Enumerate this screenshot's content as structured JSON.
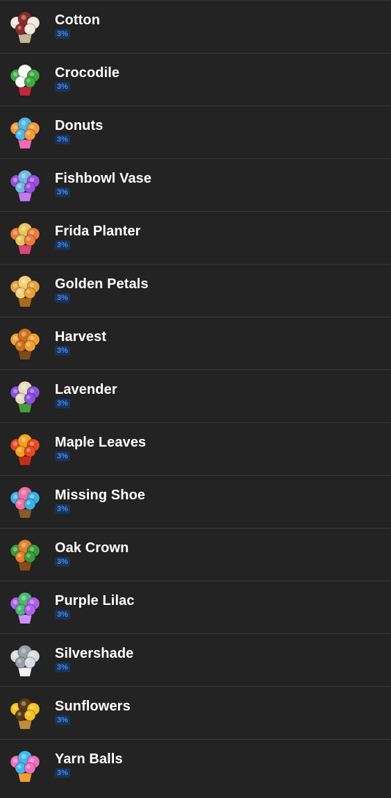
{
  "items": [
    {
      "name": "Cotton",
      "percent": "3%",
      "icon": "cotton-icon",
      "colors": [
        "#f3e8dc",
        "#8b2b2b",
        "#c9b49c"
      ]
    },
    {
      "name": "Crocodile",
      "percent": "3%",
      "icon": "crocodile-icon",
      "colors": [
        "#3fa844",
        "#ffffff",
        "#c0283a"
      ]
    },
    {
      "name": "Donuts",
      "percent": "3%",
      "icon": "donuts-icon",
      "colors": [
        "#f29a3d",
        "#4fb6e8",
        "#f06bb0"
      ]
    },
    {
      "name": "Fishbowl Vase",
      "percent": "3%",
      "icon": "fishbowl-vase-icon",
      "colors": [
        "#9b4fe0",
        "#6fb8e0",
        "#c37af0"
      ]
    },
    {
      "name": "Frida Planter",
      "percent": "3%",
      "icon": "frida-planter-icon",
      "colors": [
        "#f07a3a",
        "#e8c55a",
        "#d44a7a"
      ]
    },
    {
      "name": "Golden Petals",
      "percent": "3%",
      "icon": "golden-petals-icon",
      "colors": [
        "#e8a23a",
        "#f5cf7a",
        "#a86a1e"
      ]
    },
    {
      "name": "Harvest",
      "percent": "3%",
      "icon": "harvest-icon",
      "colors": [
        "#f0a030",
        "#d0701e",
        "#7a4a20"
      ]
    },
    {
      "name": "Lavender",
      "percent": "3%",
      "icon": "lavender-icon",
      "colors": [
        "#8a50e0",
        "#e8dcc0",
        "#4a9a3a"
      ]
    },
    {
      "name": "Maple Leaves",
      "percent": "3%",
      "icon": "maple-leaves-icon",
      "colors": [
        "#e84a1e",
        "#f5a020",
        "#c0301a"
      ]
    },
    {
      "name": "Missing Shoe",
      "percent": "3%",
      "icon": "missing-shoe-icon",
      "colors": [
        "#3ab0e8",
        "#f070a0",
        "#8a5a2a"
      ]
    },
    {
      "name": "Oak Crown",
      "percent": "3%",
      "icon": "oak-crown-icon",
      "colors": [
        "#3a9a3a",
        "#e0802a",
        "#8a4a20"
      ]
    },
    {
      "name": "Purple Lilac",
      "percent": "3%",
      "icon": "purple-lilac-icon",
      "colors": [
        "#b060f0",
        "#4ab870",
        "#d090ff"
      ]
    },
    {
      "name": "Silvershade",
      "percent": "3%",
      "icon": "silvershade-icon",
      "colors": [
        "#d8dce0",
        "#9aa0a8",
        "#f4f6f8"
      ]
    },
    {
      "name": "Sunflowers",
      "percent": "3%",
      "icon": "sunflowers-icon",
      "colors": [
        "#f5c020",
        "#5a3a14",
        "#c08a40"
      ]
    },
    {
      "name": "Yarn Balls",
      "percent": "3%",
      "icon": "yarn-balls-icon",
      "colors": [
        "#f070c0",
        "#40b8f0",
        "#f0a030"
      ]
    }
  ]
}
